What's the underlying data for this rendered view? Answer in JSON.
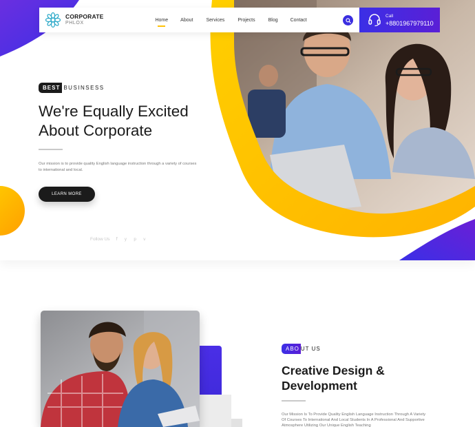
{
  "header": {
    "logo": {
      "name": "CORPORATE",
      "subtitle": "PHLOX",
      "icon": "lotus-logo-icon"
    },
    "nav": [
      {
        "label": "Home",
        "active": true
      },
      {
        "label": "About"
      },
      {
        "label": "Services"
      },
      {
        "label": "Projects"
      },
      {
        "label": "Blog"
      },
      {
        "label": "Contact"
      }
    ],
    "search_icon": "search-icon",
    "call": {
      "label": "Call",
      "number": "+8801967979110",
      "icon": "headset-icon"
    }
  },
  "hero": {
    "badge_highlight": "BEST",
    "badge_rest": "BUSINSESS",
    "title_line1": "We're Equally Excited",
    "title_line2": "About Corporate",
    "description": "Our mission is to provide quality English language instruction through a variety of courses to international and local.",
    "button": "LEARN MORE",
    "follow_label": "Follow Us",
    "social_icons": [
      "facebook-icon",
      "twitter-icon",
      "pinterest-icon",
      "vimeo-icon"
    ],
    "social_glyphs": [
      "f",
      "y",
      "p",
      "v"
    ]
  },
  "about": {
    "badge_highlight": "ABO",
    "badge_rest": "UT US",
    "title_line1": "Creative Design &",
    "title_line2": "Development",
    "description": "Our Mission Is To Provide Quality English Language Instruction Through A Variety Of Courses To International And Local Students In A Professional And Supportive Atmosphere Utilizing Our Unique English Teaching"
  },
  "colors": {
    "accent_blue": "#3b2fe6",
    "accent_purple": "#5a1fd6",
    "accent_yellow": "#ffc107",
    "dark": "#1b1b1b"
  }
}
